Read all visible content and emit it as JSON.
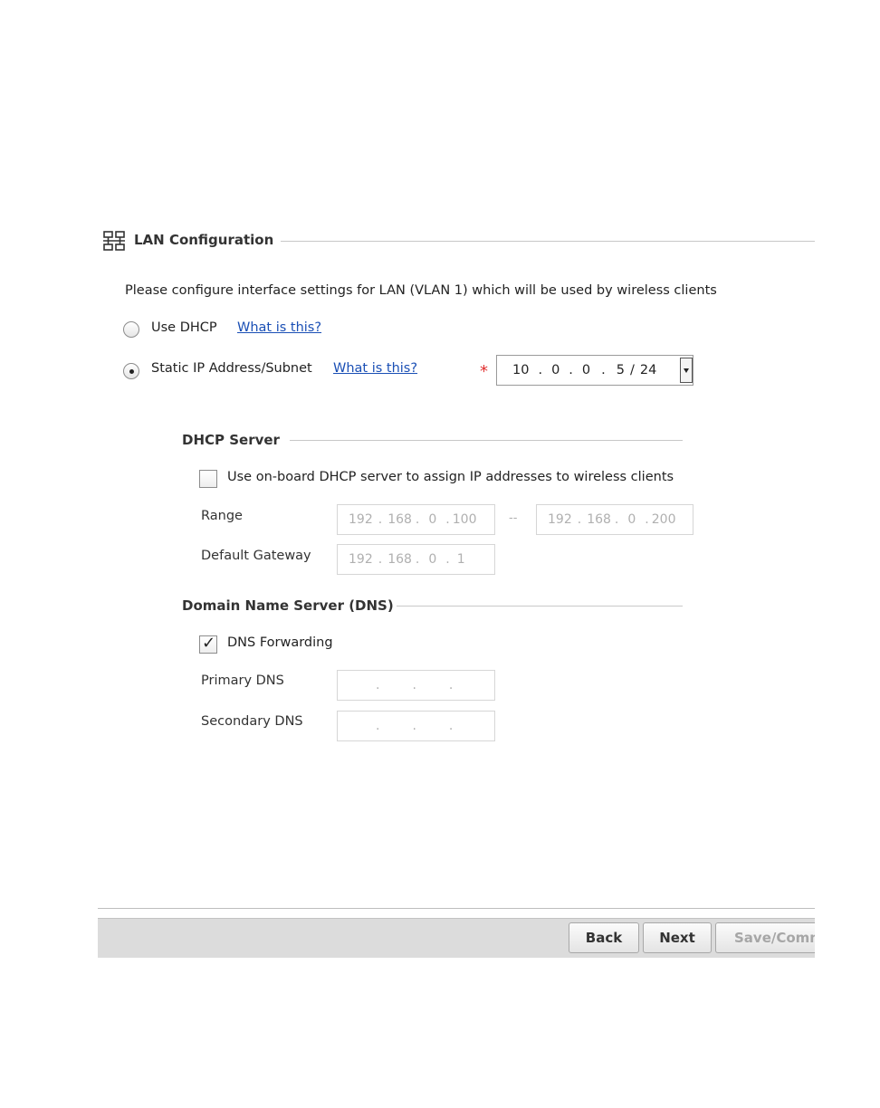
{
  "lan": {
    "title": "LAN Configuration",
    "description": "Please configure interface settings for LAN (VLAN 1) which will be used by wireless clients",
    "use_dhcp_label": "Use DHCP",
    "use_dhcp_help": "What is this?",
    "use_dhcp_checked": false,
    "static_label": "Static IP Address/Subnet",
    "static_help": "What is this?",
    "static_checked": true,
    "required_marker": "*",
    "static_ip": {
      "octet1": "10",
      "octet2": "0",
      "octet3": "0",
      "octet4": "5",
      "slash": "/",
      "mask": "24"
    }
  },
  "dhcp_server": {
    "title": "DHCP Server",
    "onboard_label": "Use on-board DHCP server to assign IP addresses to wireless clients",
    "onboard_checked": false,
    "range_label": "Range",
    "range_start": {
      "o1": "192",
      "o2": "168",
      "o3": "0",
      "o4": "100"
    },
    "range_sep": "--",
    "range_end": {
      "o1": "192",
      "o2": "168",
      "o3": "0",
      "o4": "200"
    },
    "gateway_label": "Default Gateway",
    "gateway": {
      "o1": "192",
      "o2": "168",
      "o3": "0",
      "o4": "1"
    }
  },
  "dns": {
    "title": "Domain Name Server (DNS)",
    "forwarding_label": "DNS Forwarding",
    "forwarding_checked": true,
    "check_glyph": "✓",
    "primary_label": "Primary DNS",
    "secondary_label": "Secondary DNS",
    "dot": "."
  },
  "footer": {
    "back_label": "Back",
    "next_label": "Next",
    "save_label": "Save/Commit"
  },
  "colors": {
    "link": "#1a4fb5",
    "required": "#e03030",
    "button_bar": "#dcdcdc"
  }
}
